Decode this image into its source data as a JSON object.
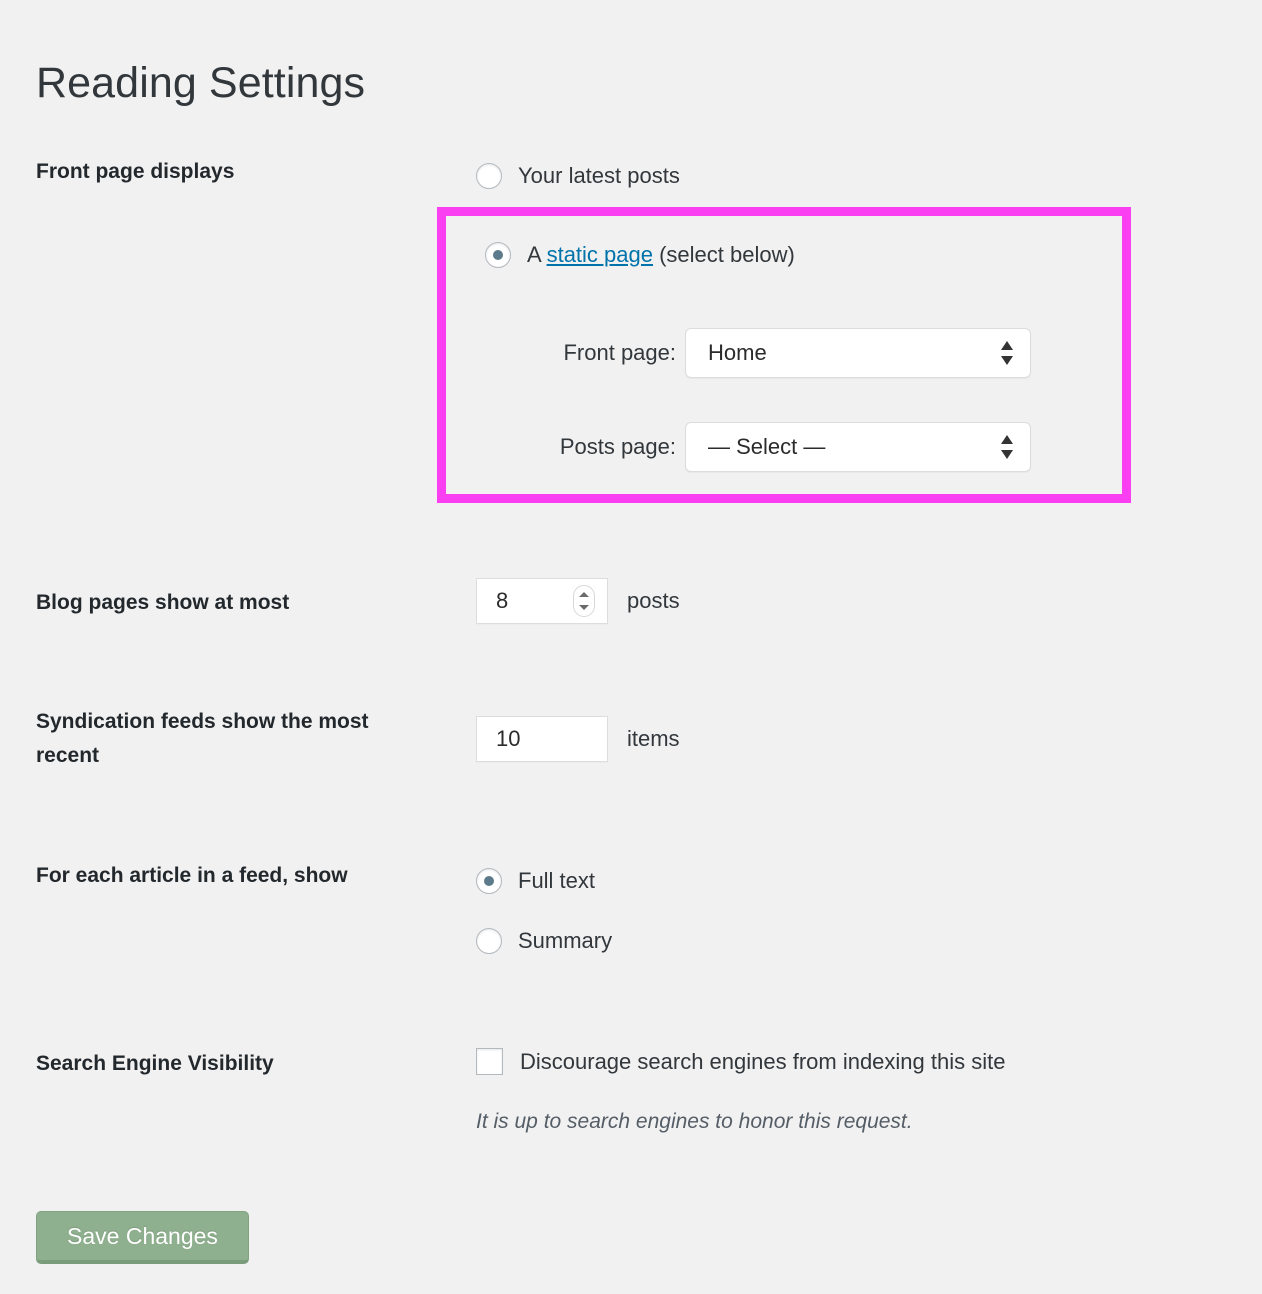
{
  "page": {
    "title": "Reading Settings"
  },
  "front_page_displays": {
    "label": "Front page displays",
    "option_latest": {
      "text": "Your latest posts",
      "selected": false
    },
    "option_static": {
      "prefix": "A ",
      "link_text": "static page",
      "suffix": " (select below)",
      "selected": true
    },
    "front_page_select": {
      "label": "Front page:",
      "value": "Home"
    },
    "posts_page_select": {
      "label": "Posts page:",
      "value": "— Select —"
    },
    "highlight_color": "#fa3ff2"
  },
  "blog_pages": {
    "label": "Blog pages show at most",
    "value": "8",
    "unit": "posts"
  },
  "syndication_feeds": {
    "label": "Syndication feeds show the most recent",
    "value": "10",
    "unit": "items"
  },
  "feed_article": {
    "label": "For each article in a feed, show",
    "option_full": {
      "text": "Full text",
      "selected": true
    },
    "option_summary": {
      "text": "Summary",
      "selected": false
    }
  },
  "search_engine_visibility": {
    "label": "Search Engine Visibility",
    "checkbox_text": "Discourage search engines from indexing this site",
    "checked": false,
    "hint": "It is up to search engines to honor this request."
  },
  "actions": {
    "save_label": "Save Changes",
    "save_color": "#8fb08f"
  }
}
